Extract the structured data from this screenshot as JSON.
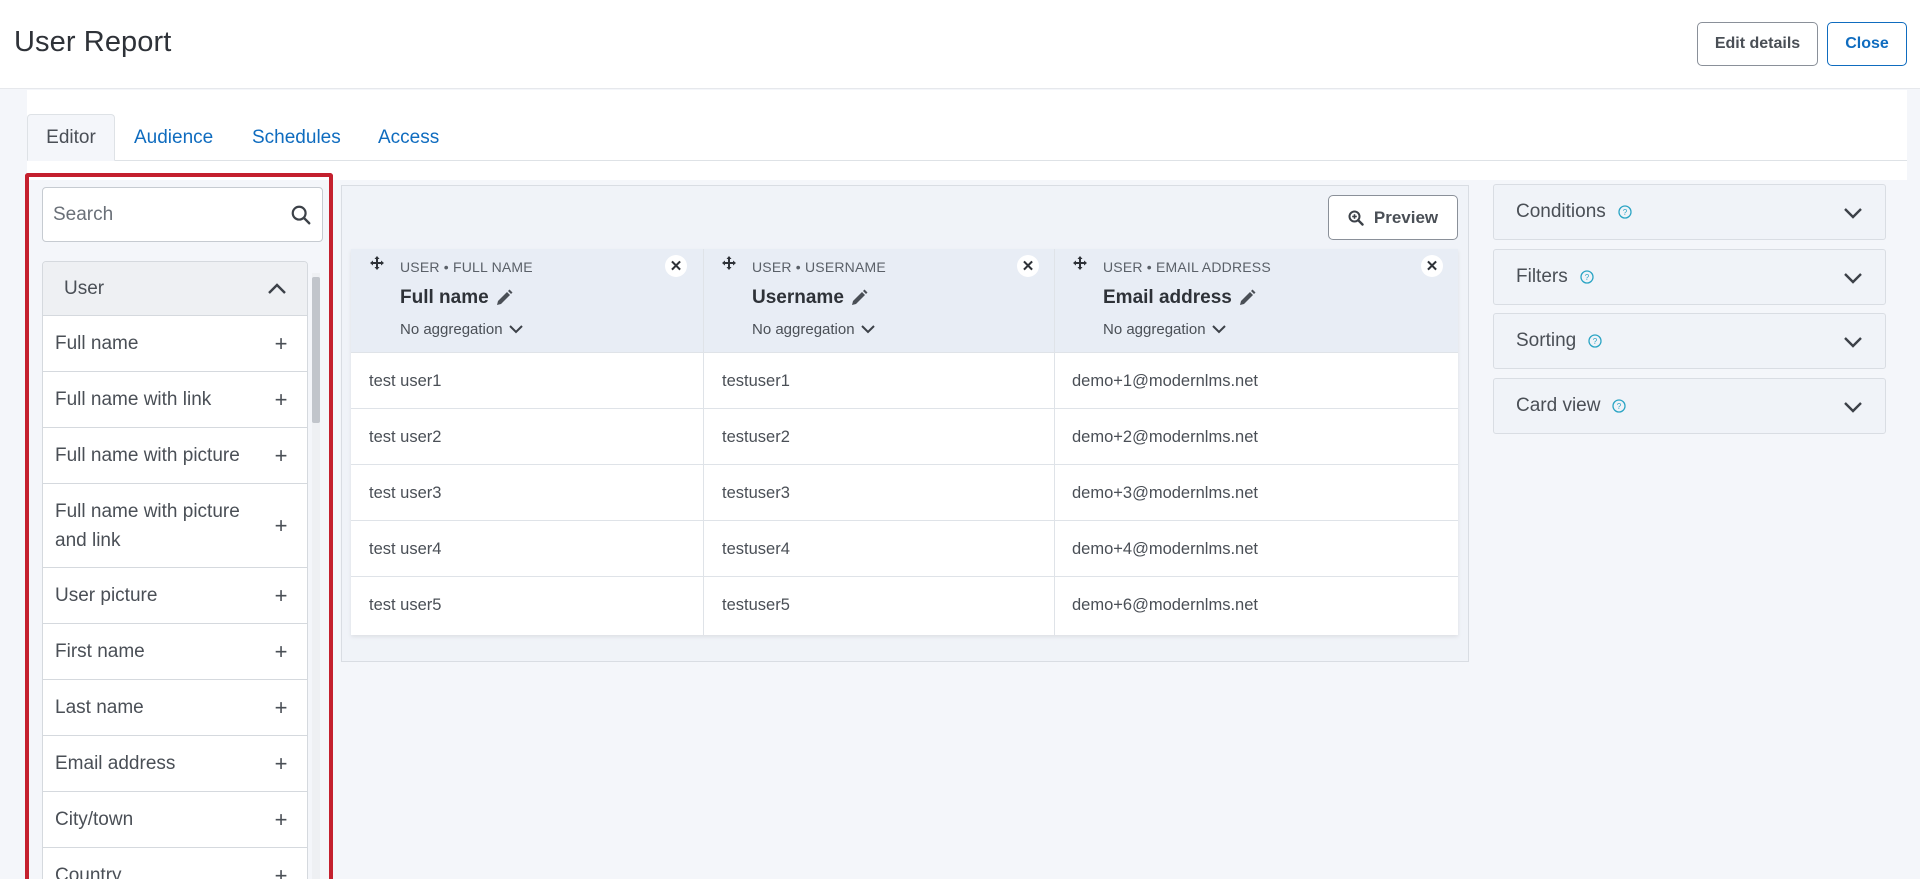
{
  "header": {
    "title": "User Report",
    "edit_label": "Edit details",
    "close_label": "Close"
  },
  "tabs": [
    {
      "label": "Editor",
      "active": true
    },
    {
      "label": "Audience"
    },
    {
      "label": "Schedules"
    },
    {
      "label": "Access"
    }
  ],
  "sidebar": {
    "search_placeholder": "Search",
    "group": "User",
    "items": [
      {
        "label": "Full name"
      },
      {
        "label": "Full name with link"
      },
      {
        "label": "Full name with picture"
      },
      {
        "label": "Full name with picture and link"
      },
      {
        "label": "User picture"
      },
      {
        "label": "First name"
      },
      {
        "label": "Last name"
      },
      {
        "label": "Email address"
      },
      {
        "label": "City/town"
      },
      {
        "label": "Country"
      }
    ]
  },
  "preview_label": "Preview",
  "table": {
    "columns": [
      {
        "source": "USER • FULL NAME",
        "title": "Full name",
        "aggregation": "No aggregation"
      },
      {
        "source": "USER • USERNAME",
        "title": "Username",
        "aggregation": "No aggregation"
      },
      {
        "source": "USER • EMAIL ADDRESS",
        "title": "Email address",
        "aggregation": "No aggregation"
      }
    ],
    "rows": [
      [
        "test user1",
        "testuser1",
        "demo+1@modernlms.net"
      ],
      [
        "test user2",
        "testuser2",
        "demo+2@modernlms.net"
      ],
      [
        "test user3",
        "testuser3",
        "demo+3@modernlms.net"
      ],
      [
        "test user4",
        "testuser4",
        "demo+4@modernlms.net"
      ],
      [
        "test user5",
        "testuser5",
        "demo+6@modernlms.net"
      ]
    ]
  },
  "accordion": [
    {
      "label": "Conditions"
    },
    {
      "label": "Filters"
    },
    {
      "label": "Sorting"
    },
    {
      "label": "Card view"
    }
  ],
  "colors": {
    "accent": "#0f6cbf",
    "highlight_border": "#c4202e"
  }
}
